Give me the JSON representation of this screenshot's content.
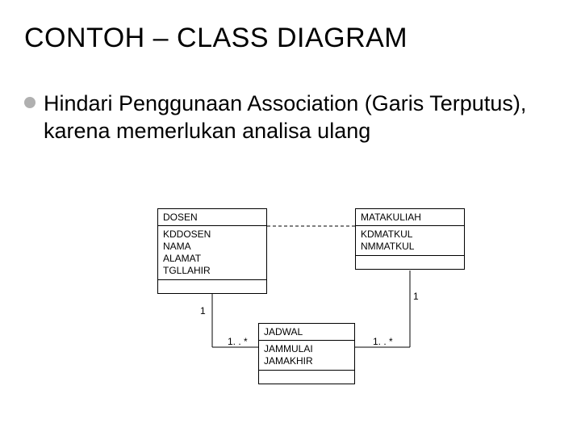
{
  "title": "CONTOH – CLASS DIAGRAM",
  "bullet": "Hindari Penggunaan Association (Garis Terputus), karena memerlukan analisa ulang",
  "classes": {
    "dosen": {
      "name": "DOSEN",
      "attrs": [
        "KDDOSEN",
        "NAMA",
        "ALAMAT",
        "TGLLAHIR"
      ]
    },
    "matakuliah": {
      "name": "MATAKULIAH",
      "attrs": [
        "KDMATKUL",
        "NMMATKUL"
      ]
    },
    "jadwal": {
      "name": "JADWAL",
      "attrs": [
        "JAMMULAI",
        "JAMAKHIR"
      ]
    }
  },
  "multiplicities": {
    "dosen_near": "1",
    "dosen_far": "1. . *",
    "matakuliah_near": "1",
    "matakuliah_far": "1. . *"
  }
}
